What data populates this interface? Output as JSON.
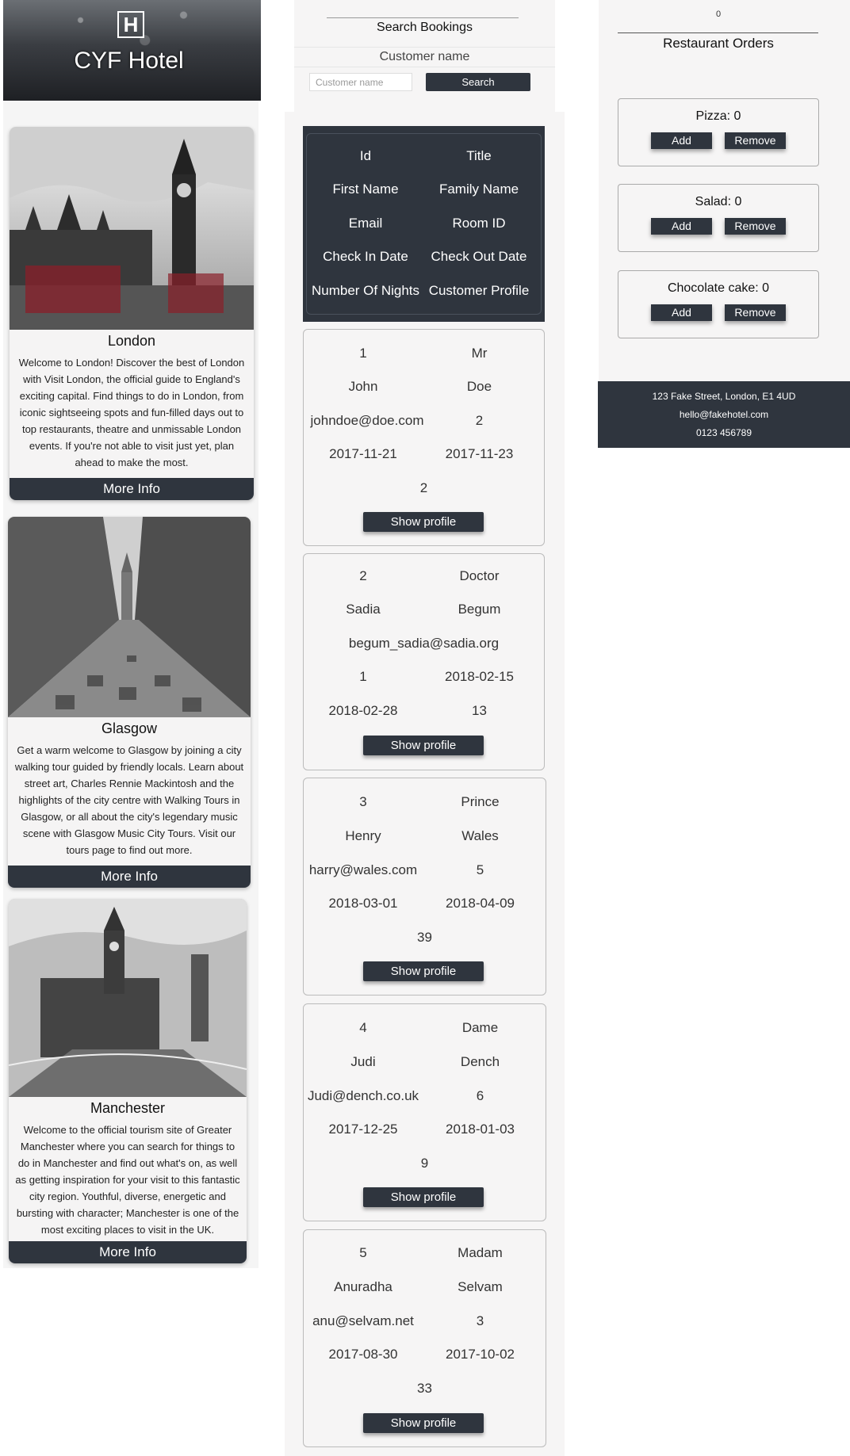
{
  "header": {
    "logo_letter": "H",
    "brand": "CYF Hotel"
  },
  "cities": [
    {
      "name": "London",
      "image": "big-ben-photo",
      "description": "Welcome to London! Discover the best of London with Visit London, the official guide to England's exciting capital. Find things to do in London, from iconic sightseeing spots and fun-filled days out to top restaurants, theatre and unmissable London events. If you're not able to visit just yet, plan ahead to make the most.",
      "button": "More Info"
    },
    {
      "name": "Glasgow",
      "image": "glasgow-street-photo",
      "description": "Get a warm welcome to Glasgow by joining a city walking tour guided by friendly locals. Learn about street art, Charles Rennie Mackintosh and the highlights of the city centre with Walking Tours in Glasgow, or all about the city's legendary music scene with Glasgow Music City Tours. Visit our tours page to find out more.",
      "button": "More Info"
    },
    {
      "name": "Manchester",
      "image": "manchester-town-hall-photo",
      "description": "Welcome to the official tourism site of Greater Manchester where you can search for things to do in Manchester and find out what's on, as well as getting inspiration for your visit to this fantastic city region. Youthful, diverse, energetic and bursting with character; Manchester is one of the most exciting places to visit in the UK.",
      "button": "More Info"
    }
  ],
  "search": {
    "title": "Search Bookings",
    "label": "Customer name",
    "placeholder": "Customer name",
    "button": "Search"
  },
  "table": {
    "headers": [
      "Id",
      "Title",
      "First Name",
      "Family Name",
      "Email",
      "Room ID",
      "Check In Date",
      "Check Out Date",
      "Number Of Nights",
      "Customer Profile"
    ],
    "show_profile_label": "Show profile",
    "rows": [
      {
        "id": "1",
        "title": "Mr",
        "first": "John",
        "surname": "Doe",
        "email": "johndoe@doe.com",
        "room": "2",
        "check_in": "2017-11-21",
        "check_out": "2017-11-23",
        "nights": "2"
      },
      {
        "id": "2",
        "title": "Doctor",
        "first": "Sadia",
        "surname": "Begum",
        "email": "begum_sadia@sadia.org",
        "room": "1",
        "check_in": "2018-02-15",
        "check_out": "2018-02-28",
        "nights": "13"
      },
      {
        "id": "3",
        "title": "Prince",
        "first": "Henry",
        "surname": "Wales",
        "email": "harry@wales.com",
        "room": "5",
        "check_in": "2018-03-01",
        "check_out": "2018-04-09",
        "nights": "39"
      },
      {
        "id": "4",
        "title": "Dame",
        "first": "Judi",
        "surname": "Dench",
        "email": "Judi@dench.co.uk",
        "room": "6",
        "check_in": "2017-12-25",
        "check_out": "2018-01-03",
        "nights": "9"
      },
      {
        "id": "5",
        "title": "Madam",
        "first": "Anuradha",
        "surname": "Selvam",
        "email": "anu@selvam.net",
        "room": "3",
        "check_in": "2017-08-30",
        "check_out": "2017-10-02",
        "nights": "33"
      }
    ]
  },
  "counter": "0",
  "orders": {
    "title": "Restaurant Orders",
    "add_label": "Add",
    "remove_label": "Remove",
    "items": [
      {
        "label": "Pizza: 0"
      },
      {
        "label": "Salad: 0"
      },
      {
        "label": "Chocolate cake: 0"
      }
    ]
  },
  "footer": {
    "address": "123 Fake Street, London, E1 4UD",
    "email": "hello@fakehotel.com",
    "phone": "0123 456789"
  }
}
